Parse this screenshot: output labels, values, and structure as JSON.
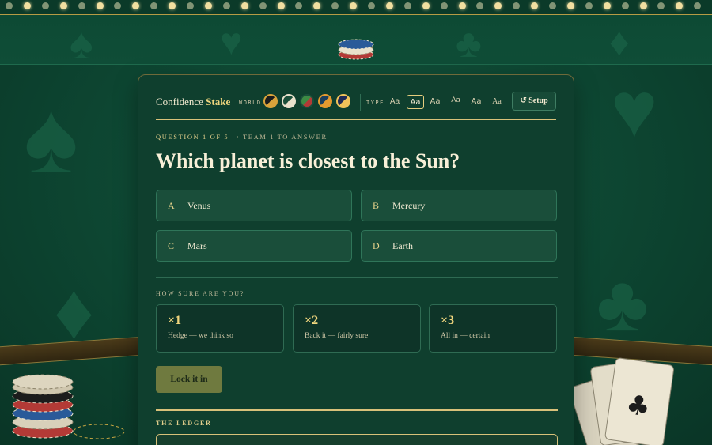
{
  "header": {
    "brand_prefix": "Confidence",
    "brand_highlight": "Stake",
    "world_label": "WORLD",
    "type_label": "TYPE",
    "type_options": [
      "Aa",
      "Aa",
      "Aa",
      "Aa",
      "Aa",
      "Aa"
    ],
    "setup_icon": "↺",
    "setup_label": "Setup"
  },
  "question": {
    "meta": "QUESTION 1 OF 5",
    "team": "· TEAM 1 TO ANSWER",
    "text": "Which planet is closest to the Sun?"
  },
  "answers": [
    {
      "letter": "A",
      "text": "Venus"
    },
    {
      "letter": "B",
      "text": "Mercury"
    },
    {
      "letter": "C",
      "text": "Mars"
    },
    {
      "letter": "D",
      "text": "Earth"
    }
  ],
  "confidence": {
    "label": "HOW SURE ARE YOU?",
    "options": [
      {
        "mult": "×1",
        "desc": "Hedge — we think so"
      },
      {
        "mult": "×2",
        "desc": "Back it — fairly sure"
      },
      {
        "mult": "×3",
        "desc": "All in — certain"
      }
    ]
  },
  "lock_label": "Lock it in",
  "ledger": {
    "label": "THE LEDGER"
  },
  "colors": {
    "accent": "#f0d67e",
    "felt": "#0f3f2e",
    "border": "#d8c17a"
  },
  "icons": {
    "setup": "reset-icon",
    "club": "club-suit-icon"
  }
}
